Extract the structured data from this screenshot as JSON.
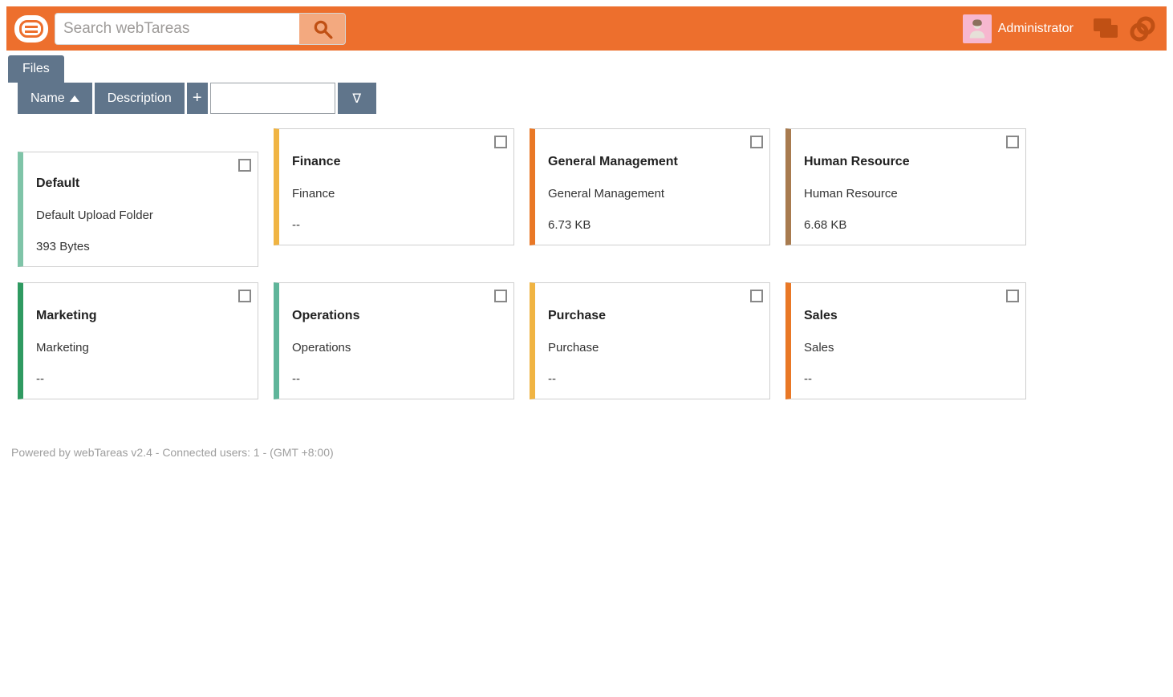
{
  "search": {
    "placeholder": "Search webTareas"
  },
  "user": {
    "name": "Administrator"
  },
  "tabs": {
    "files": "Files"
  },
  "toolbar": {
    "name_label": "Name",
    "desc_label": "Description",
    "plus_label": "+",
    "filter_glyph": "∇"
  },
  "colors": {
    "green_light": "#7fc4a8",
    "yellow": "#f0b443",
    "orange": "#e97826",
    "brown": "#a87b4f",
    "green_dark": "#2f9a61",
    "teal": "#5fb59a"
  },
  "cards": [
    {
      "title": "Default",
      "desc": "Default Upload Folder",
      "size": "393 Bytes",
      "color_key": "green_light",
      "first": true
    },
    {
      "title": "Finance",
      "desc": "Finance",
      "size": "--",
      "color_key": "yellow"
    },
    {
      "title": "General Management",
      "desc": "General Management",
      "size": "6.73 KB",
      "color_key": "orange"
    },
    {
      "title": "Human Resource",
      "desc": "Human Resource",
      "size": "6.68 KB",
      "color_key": "brown"
    },
    {
      "title": "Marketing",
      "desc": "Marketing",
      "size": "--",
      "color_key": "green_dark"
    },
    {
      "title": "Operations",
      "desc": "Operations",
      "size": "--",
      "color_key": "teal"
    },
    {
      "title": "Purchase",
      "desc": "Purchase",
      "size": "--",
      "color_key": "yellow"
    },
    {
      "title": "Sales",
      "desc": "Sales",
      "size": "--",
      "color_key": "orange"
    }
  ],
  "footer": {
    "text": "Powered by webTareas v2.4 - Connected users: 1 - (GMT +8:00)"
  }
}
